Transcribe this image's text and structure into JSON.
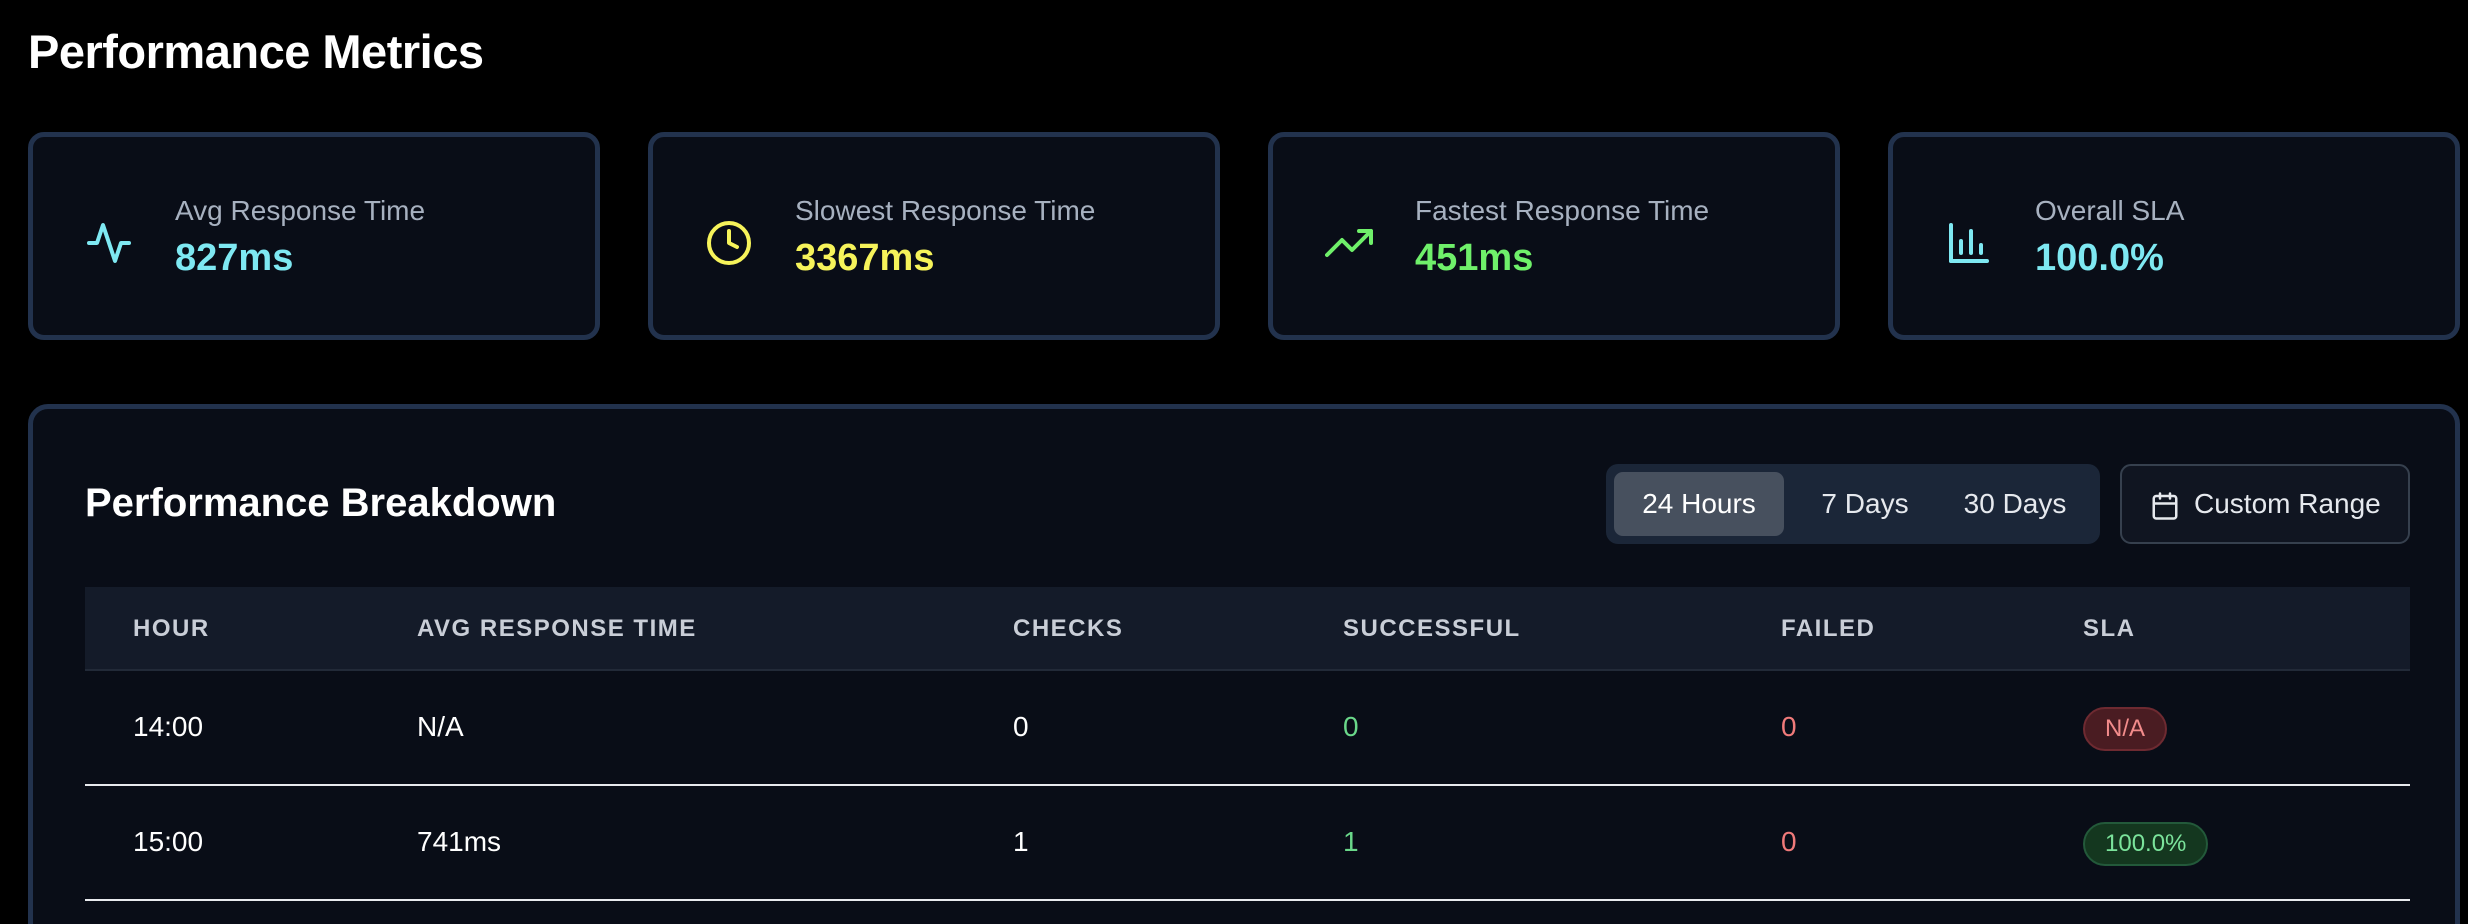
{
  "page": {
    "title": "Performance Metrics"
  },
  "cards": [
    {
      "label": "Avg Response Time",
      "value": "827ms",
      "icon": "activity-icon",
      "color": "#7ee8f2"
    },
    {
      "label": "Slowest Response Time",
      "value": "3367ms",
      "icon": "clock-icon",
      "color": "#f6f35a"
    },
    {
      "label": "Fastest Response Time",
      "value": "451ms",
      "icon": "trending-up-icon",
      "color": "#6ff06a"
    },
    {
      "label": "Overall SLA",
      "value": "100.0%",
      "icon": "bar-chart-icon",
      "color": "#7ee8f2"
    }
  ],
  "breakdown": {
    "title": "Performance Breakdown",
    "ranges": [
      {
        "label": "24 Hours",
        "active": true
      },
      {
        "label": "7 Days",
        "active": false
      },
      {
        "label": "30 Days",
        "active": false
      }
    ],
    "custom_range_label": "Custom Range",
    "columns": [
      "HOUR",
      "AVG RESPONSE TIME",
      "CHECKS",
      "SUCCESSFUL",
      "FAILED",
      "SLA"
    ],
    "rows": [
      {
        "hour": "14:00",
        "avg": "N/A",
        "checks": "0",
        "successful": "0",
        "failed": "0",
        "sla": "N/A",
        "sla_status": "na"
      },
      {
        "hour": "15:00",
        "avg": "741ms",
        "checks": "1",
        "successful": "1",
        "failed": "0",
        "sla": "100.0%",
        "sla_status": "ok"
      }
    ]
  },
  "colors": {
    "accent_cyan": "#7ee8f2",
    "accent_yellow": "#f6f35a",
    "accent_green": "#6ff06a",
    "success_text": "#6ad88a",
    "failed_text": "#f07a7a"
  }
}
